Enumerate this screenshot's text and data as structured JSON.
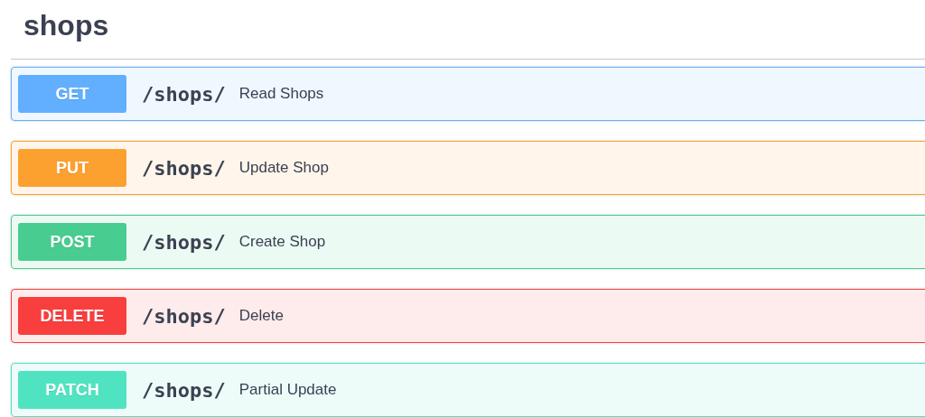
{
  "section": {
    "title": "shops"
  },
  "operations": [
    {
      "method": "GET",
      "path": "/shops/",
      "summary": "Read Shops",
      "color": "#61affe"
    },
    {
      "method": "PUT",
      "path": "/shops/",
      "summary": "Update Shop",
      "color": "#fca130"
    },
    {
      "method": "POST",
      "path": "/shops/",
      "summary": "Create Shop",
      "color": "#49cc90"
    },
    {
      "method": "DELETE",
      "path": "/shops/",
      "summary": "Delete",
      "color": "#f93e3e"
    },
    {
      "method": "PATCH",
      "path": "/shops/",
      "summary": "Partial Update",
      "color": "#50e3c2"
    }
  ]
}
